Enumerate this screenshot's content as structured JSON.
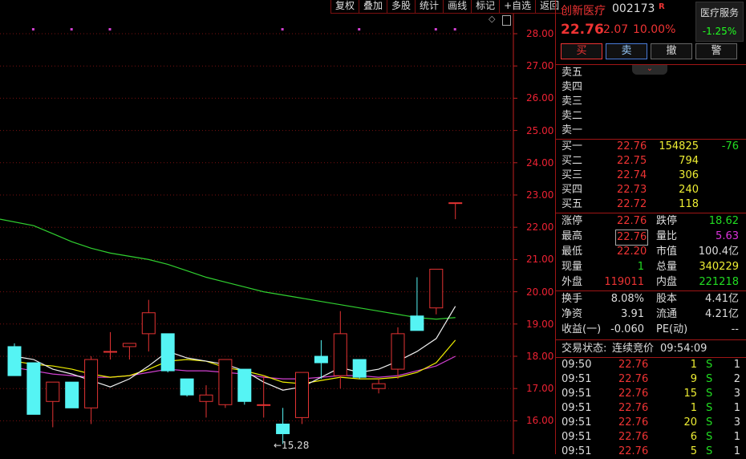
{
  "toolbar": [
    "复权",
    "叠加",
    "多股",
    "统计",
    "画线",
    "标记",
    "+自选",
    "返回"
  ],
  "y_axis_labels": [
    "28.00",
    "27.00",
    "26.00",
    "25.00",
    "24.00",
    "23.00",
    "22.00",
    "21.00",
    "20.00",
    "19.00",
    "18.00",
    "17.00",
    "16.00"
  ],
  "low_price_label": "←15.28",
  "chart_data": {
    "type": "candlestick",
    "ylim": [
      15.4,
      28.4
    ],
    "candles": [
      {
        "o": 18.3,
        "h": 18.4,
        "l": 17.4,
        "c": 17.4
      },
      {
        "o": 17.8,
        "h": 17.8,
        "l": 16.2,
        "c": 16.2
      },
      {
        "o": 16.6,
        "h": 17.2,
        "l": 15.8,
        "c": 17.2
      },
      {
        "o": 17.2,
        "h": 17.2,
        "l": 16.4,
        "c": 16.4
      },
      {
        "o": 16.4,
        "h": 18.0,
        "l": 15.9,
        "c": 17.9
      },
      {
        "o": 18.15,
        "h": 18.75,
        "l": 17.9,
        "c": 18.15
      },
      {
        "o": 18.3,
        "h": 18.4,
        "l": 17.9,
        "c": 18.4
      },
      {
        "o": 18.7,
        "h": 19.75,
        "l": 18.15,
        "c": 19.35
      },
      {
        "o": 18.7,
        "h": 18.7,
        "l": 17.5,
        "c": 17.55
      },
      {
        "o": 17.3,
        "h": 17.3,
        "l": 16.75,
        "c": 16.8
      },
      {
        "o": 16.6,
        "h": 17.1,
        "l": 16.1,
        "c": 16.8
      },
      {
        "o": 16.5,
        "h": 17.9,
        "l": 16.4,
        "c": 17.9
      },
      {
        "o": 17.6,
        "h": 17.6,
        "l": 16.5,
        "c": 16.6
      },
      {
        "o": 16.5,
        "h": 17.4,
        "l": 16.1,
        "c": 16.5
      },
      {
        "o": 15.9,
        "h": 16.4,
        "l": 15.28,
        "c": 15.6
      },
      {
        "o": 16.1,
        "h": 17.5,
        "l": 15.9,
        "c": 17.5
      },
      {
        "o": 18.0,
        "h": 18.5,
        "l": 17.3,
        "c": 17.8
      },
      {
        "o": 17.4,
        "h": 19.4,
        "l": 17.0,
        "c": 18.7
      },
      {
        "o": 17.9,
        "h": 17.9,
        "l": 17.3,
        "c": 17.35
      },
      {
        "o": 17.0,
        "h": 17.3,
        "l": 16.85,
        "c": 17.15
      },
      {
        "o": 17.6,
        "h": 18.9,
        "l": 17.3,
        "c": 18.7
      },
      {
        "o": 19.25,
        "h": 20.45,
        "l": 18.8,
        "c": 18.8
      },
      {
        "o": 19.5,
        "h": 20.7,
        "l": 19.3,
        "c": 20.7
      },
      {
        "o": 22.76,
        "h": 22.76,
        "l": 22.25,
        "c": 22.76
      }
    ],
    "ma_white": [
      18.0,
      17.9,
      17.6,
      17.45,
      17.25,
      17.05,
      17.3,
      17.7,
      18.15,
      17.95,
      17.85,
      17.75,
      17.55,
      17.2,
      16.95,
      17.05,
      17.35,
      17.65,
      17.5,
      17.6,
      17.85,
      18.15,
      18.55,
      19.55
    ],
    "ma_yellow": [
      17.85,
      17.75,
      17.7,
      17.6,
      17.45,
      17.35,
      17.4,
      17.6,
      17.85,
      17.9,
      17.85,
      17.65,
      17.55,
      17.4,
      17.2,
      17.15,
      17.25,
      17.35,
      17.3,
      17.3,
      17.35,
      17.5,
      17.8,
      18.5
    ],
    "ma_magenta": [
      17.65,
      17.55,
      17.45,
      17.4,
      17.35,
      17.35,
      17.4,
      17.5,
      17.6,
      17.55,
      17.55,
      17.5,
      17.45,
      17.35,
      17.3,
      17.3,
      17.35,
      17.4,
      17.4,
      17.35,
      17.4,
      17.55,
      17.7,
      18.0
    ],
    "ma_green": [
      22.25,
      22.05,
      21.8,
      21.55,
      21.35,
      21.2,
      21.1,
      21.0,
      20.85,
      20.65,
      20.45,
      20.3,
      20.15,
      20.0,
      19.9,
      19.8,
      19.7,
      19.6,
      19.5,
      19.4,
      19.3,
      19.2,
      19.15,
      19.2
    ],
    "markers": [
      1,
      3,
      5,
      14,
      18,
      22,
      23
    ]
  },
  "stock": {
    "name": "创新医疗",
    "code": "002173",
    "flag": "R",
    "sector_name": "医疗服务",
    "sector_pct": "-1.25%",
    "price": "22.76",
    "change": "2.07",
    "pct": "10.00%"
  },
  "buttons": {
    "buy": "买",
    "sell": "卖",
    "cancel": "撤",
    "alert": "警"
  },
  "tab_arrow": "⌄",
  "sell_levels": [
    {
      "label": "卖五",
      "price": "",
      "vol": ""
    },
    {
      "label": "卖四",
      "price": "",
      "vol": ""
    },
    {
      "label": "卖三",
      "price": "",
      "vol": ""
    },
    {
      "label": "卖二",
      "price": "",
      "vol": ""
    },
    {
      "label": "卖一",
      "price": "",
      "vol": ""
    }
  ],
  "buy_levels": [
    {
      "label": "买一",
      "price": "22.76",
      "vol": "154825",
      "delta": "-76"
    },
    {
      "label": "买二",
      "price": "22.75",
      "vol": "794",
      "delta": ""
    },
    {
      "label": "买三",
      "price": "22.74",
      "vol": "306",
      "delta": ""
    },
    {
      "label": "买四",
      "price": "22.73",
      "vol": "240",
      "delta": ""
    },
    {
      "label": "买五",
      "price": "22.72",
      "vol": "118",
      "delta": ""
    }
  ],
  "quote": {
    "limit_up_label": "涨停",
    "limit_up": "22.76",
    "limit_down_label": "跌停",
    "limit_down": "18.62",
    "high_label": "最高",
    "high": "22.76",
    "vol_ratio_label": "量比",
    "vol_ratio": "5.63",
    "low_label": "最低",
    "low": "22.20",
    "mktcap_label": "市值",
    "mktcap": "100.4亿",
    "last_vol_label": "现量",
    "last_vol": "1",
    "total_vol_label": "总量",
    "total_vol": "340229",
    "outer_label": "外盘",
    "outer": "119011",
    "inner_label": "内盘",
    "inner": "221218"
  },
  "fundamentals": {
    "turnover_label": "换手",
    "turnover": "8.08%",
    "equity_label": "股本",
    "equity": "4.41亿",
    "nav_label": "净资",
    "nav": "3.91",
    "float_label": "流通",
    "float": "4.21亿",
    "eps_label": "收益(一)",
    "eps": "-0.060",
    "pe_label": "PE(动)",
    "pe": "--"
  },
  "status": {
    "label": "交易状态:",
    "value": "连续竞价",
    "time": "09:54:09"
  },
  "ticks": [
    {
      "time": "09:50",
      "price": "22.76",
      "vol": "1",
      "side": "S",
      "n": "1"
    },
    {
      "time": "09:51",
      "price": "22.76",
      "vol": "9",
      "side": "S",
      "n": "2"
    },
    {
      "time": "09:51",
      "price": "22.76",
      "vol": "15",
      "side": "S",
      "n": "3"
    },
    {
      "time": "09:51",
      "price": "22.76",
      "vol": "1",
      "side": "S",
      "n": "1"
    },
    {
      "time": "09:51",
      "price": "22.76",
      "vol": "20",
      "side": "S",
      "n": "3"
    },
    {
      "time": "09:51",
      "price": "22.76",
      "vol": "6",
      "side": "S",
      "n": "1"
    },
    {
      "time": "09:51",
      "price": "22.76",
      "vol": "5",
      "side": "S",
      "n": "1"
    }
  ],
  "colors": {
    "up": "#e33333",
    "down": "#55f4f4",
    "ma_white": "#f0f0f0",
    "ma_yellow": "#f0f000",
    "ma_magenta": "#d040d0",
    "ma_green": "#30d030",
    "grid": "#7a1010",
    "marker": "#d040d0"
  }
}
